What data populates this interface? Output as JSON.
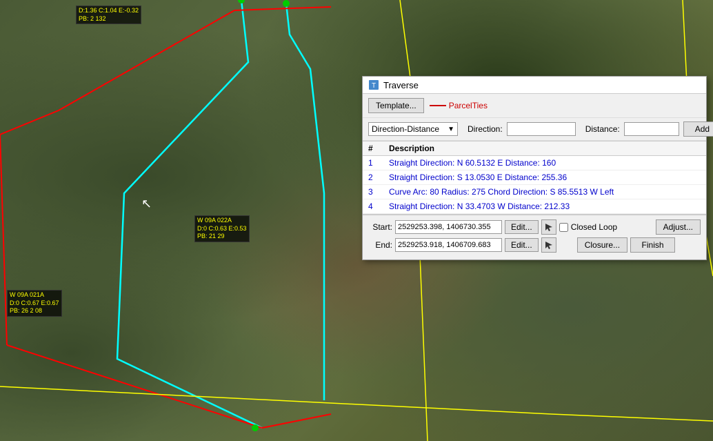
{
  "dialog": {
    "title": "Traverse",
    "title_icon": "📐",
    "toolbar": {
      "template_btn": "Template...",
      "parcel_ties_label": "ParcelTies"
    },
    "row1": {
      "direction_distance_option": "Direction-Distance",
      "direction_label": "Direction:",
      "distance_label": "Distance:",
      "add_btn": "Add"
    },
    "table": {
      "columns": [
        "#",
        "Description"
      ],
      "rows": [
        {
          "num": "1",
          "desc": "Straight  Direction: N 60.5132 E  Distance: 160"
        },
        {
          "num": "2",
          "desc": "Straight  Direction: S 13.0530 E  Distance: 255.36"
        },
        {
          "num": "3",
          "desc": "Curve  Arc: 80  Radius: 275  Chord Direction: S 85.5513 W  Left"
        },
        {
          "num": "4",
          "desc": "Straight  Direction: N 33.4703 W  Distance: 212.33"
        }
      ]
    },
    "bottom": {
      "start_label": "Start:",
      "start_value": "2529253.398, 1406730.355",
      "end_label": "End:",
      "end_value": "2529253.918, 1406709.683",
      "edit_btn": "Edit...",
      "closed_loop_label": "Closed Loop",
      "adjust_btn": "Adjust...",
      "closure_btn": "Closure...",
      "finish_btn": "Finish"
    }
  },
  "map_labels": [
    {
      "id": "label1",
      "text": "D:1.36  C:1.04  E:-0.32\nPB: 2  132",
      "top": "8",
      "left": "110"
    },
    {
      "id": "label2",
      "text": "W 09A 022A\nD:0  C:0.63  E:0.53\nPB: 21  29",
      "top": "312",
      "left": "282"
    },
    {
      "id": "label3",
      "text": "W 09A 021A\nD:0  C:0.67  E:0.67\nPB: 26  2  08",
      "top": "420",
      "left": "10"
    }
  ]
}
